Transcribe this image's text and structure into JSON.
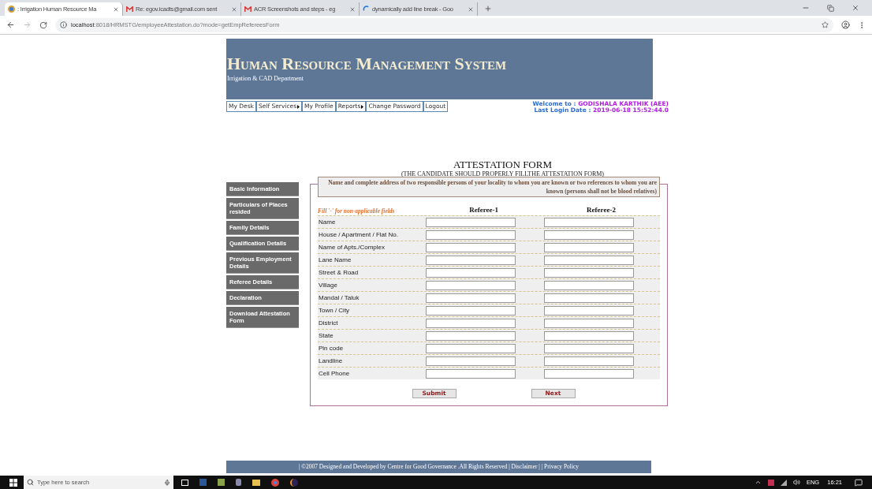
{
  "browser": {
    "tabs": [
      {
        "title": ": Irrigation Human Resource Ma",
        "selected": true,
        "kind": "app"
      },
      {
        "title": "Re: egov.icadts@gmail.com sent",
        "selected": false,
        "kind": "mail"
      },
      {
        "title": "ACR Screenshots and steps - eg",
        "selected": false,
        "kind": "mail"
      },
      {
        "title": "dynamically add line break - Goo",
        "selected": false,
        "kind": "loading"
      }
    ],
    "url_host": "localhost",
    "url_rest": ":8018/HRMSTG/employeeAttestation.do?mode=getEmpRefereesForm"
  },
  "header": {
    "title": "Human Resource Management System",
    "subtitle": "Irrigation & CAD Department"
  },
  "menu": [
    {
      "label": "My Desk",
      "submenu": false
    },
    {
      "label": "Self Services",
      "submenu": true
    },
    {
      "label": "My Profile",
      "submenu": false
    },
    {
      "label": "Reports",
      "submenu": true
    },
    {
      "label": "Change Password",
      "submenu": false
    },
    {
      "label": "Logout",
      "submenu": false
    }
  ],
  "user": {
    "welcome_label": "Welcome to : ",
    "name": "GODISHALA KARTHIK (AEE)",
    "login_label": "Last Login Date : ",
    "login_date": "2019-06-18 15:52:44.0"
  },
  "form": {
    "title": "ATTESTATION FORM",
    "subtitle": "(THE CANDIDATE SHOULD PROPERLY FILLTHE ATTESTATION FORM)",
    "note": "Name and complete address of two responsible persons of your locality to whom you are known or two references to whom you are known (persons shall not be blood relatives)",
    "hint": "Fill '-' for non-applicable fields",
    "columns": [
      "Referee-1",
      "Referee-2"
    ],
    "fields": [
      "Name",
      "House / Apartment / Flat No.",
      "Name of Apts./Complex",
      "Lane Name",
      "Street & Road",
      "Village",
      "Mandal / Taluk",
      "Town / City",
      "District",
      "State",
      "Pin code",
      "Landline",
      "Cell Phone"
    ],
    "buttons": [
      "Submit",
      "Next"
    ]
  },
  "sidebar": [
    "Basic Information",
    "Particulars of Places resided",
    "Family Details",
    "Qualification Details",
    "Previous Employment Details",
    "Referee Details",
    "Declaration",
    "Download Attestation Form"
  ],
  "footer": "| ©2007 Designed and Developed by Centre for Good Governance .All Rights Reserved | Disclaimer | | Privacy Policy",
  "taskbar": {
    "search_placeholder": "Type here to search",
    "language": "ENG",
    "time": "16:21"
  }
}
